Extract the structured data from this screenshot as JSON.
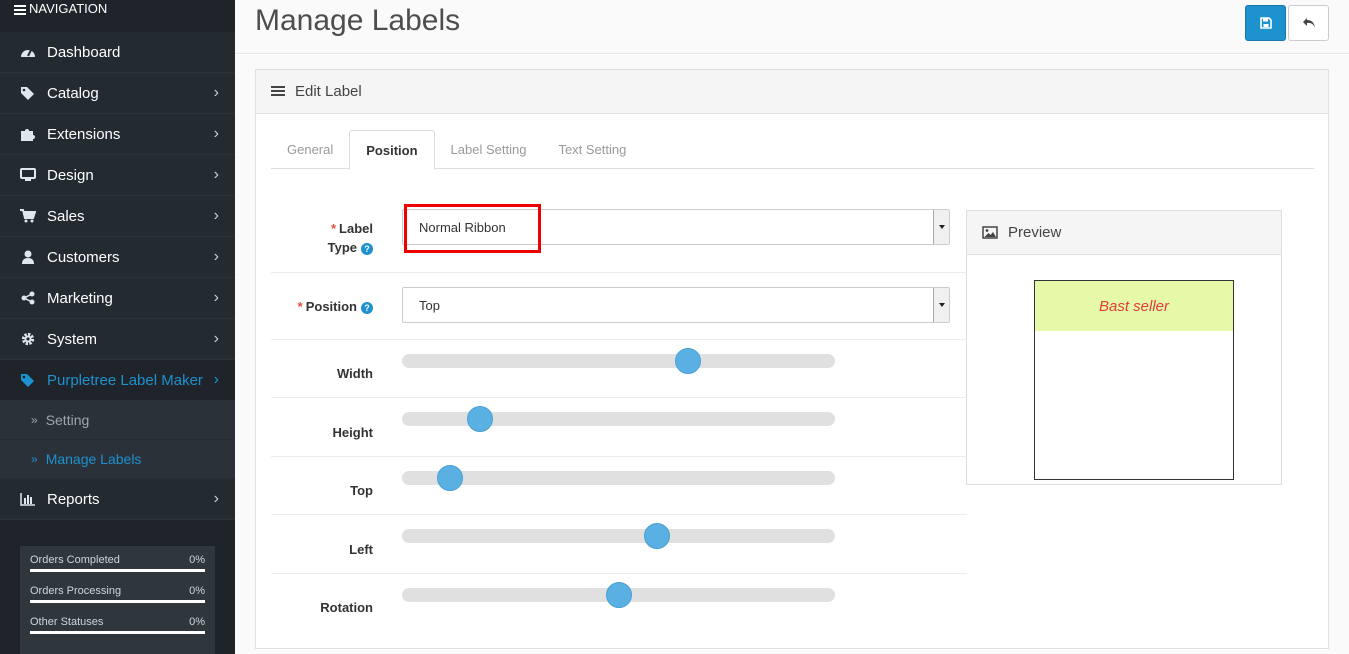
{
  "nav": {
    "header": "NAVIGATION",
    "items": [
      {
        "label": "Dashboard",
        "icon": "dashboard-icon"
      },
      {
        "label": "Catalog",
        "icon": "tags-icon"
      },
      {
        "label": "Extensions",
        "icon": "puzzle-icon"
      },
      {
        "label": "Design",
        "icon": "monitor-icon"
      },
      {
        "label": "Sales",
        "icon": "cart-icon"
      },
      {
        "label": "Customers",
        "icon": "user-icon"
      },
      {
        "label": "Marketing",
        "icon": "share-icon"
      },
      {
        "label": "System",
        "icon": "gear-icon"
      },
      {
        "label": "Purpletree Label Maker",
        "icon": "tag-icon"
      },
      {
        "label": "Reports",
        "icon": "bar-chart-icon"
      }
    ],
    "submenu": [
      {
        "label": "Setting"
      },
      {
        "label": "Manage Labels"
      }
    ],
    "stats": [
      {
        "label": "Orders Completed",
        "value": "0%"
      },
      {
        "label": "Orders Processing",
        "value": "0%"
      },
      {
        "label": "Other Statuses",
        "value": "0%"
      }
    ]
  },
  "header": {
    "title": "Manage Labels"
  },
  "panel": {
    "title": "Edit Label"
  },
  "tabs": [
    {
      "label": "General"
    },
    {
      "label": "Position"
    },
    {
      "label": "Label Setting"
    },
    {
      "label": "Text Setting"
    }
  ],
  "form": {
    "label_type": {
      "label1": "Label",
      "label2": "Type",
      "value": "Normal Ribbon"
    },
    "position": {
      "label": "Position",
      "value": "Top"
    },
    "sliders": [
      {
        "label": "Width",
        "value": 0.66
      },
      {
        "label": "Height",
        "value": 0.18
      },
      {
        "label": "Top",
        "value": 0.11
      },
      {
        "label": "Left",
        "value": 0.59
      },
      {
        "label": "Rotation",
        "value": 0.5
      }
    ]
  },
  "preview": {
    "title": "Preview",
    "ribbon_text": "Bast seller"
  },
  "colors": {
    "accent": "#1e91cf",
    "sidebar": "#1e2429",
    "ribbon_bg": "#e5f9a8",
    "ribbon_text": "#e03c3c",
    "highlight": "#ee0000"
  }
}
